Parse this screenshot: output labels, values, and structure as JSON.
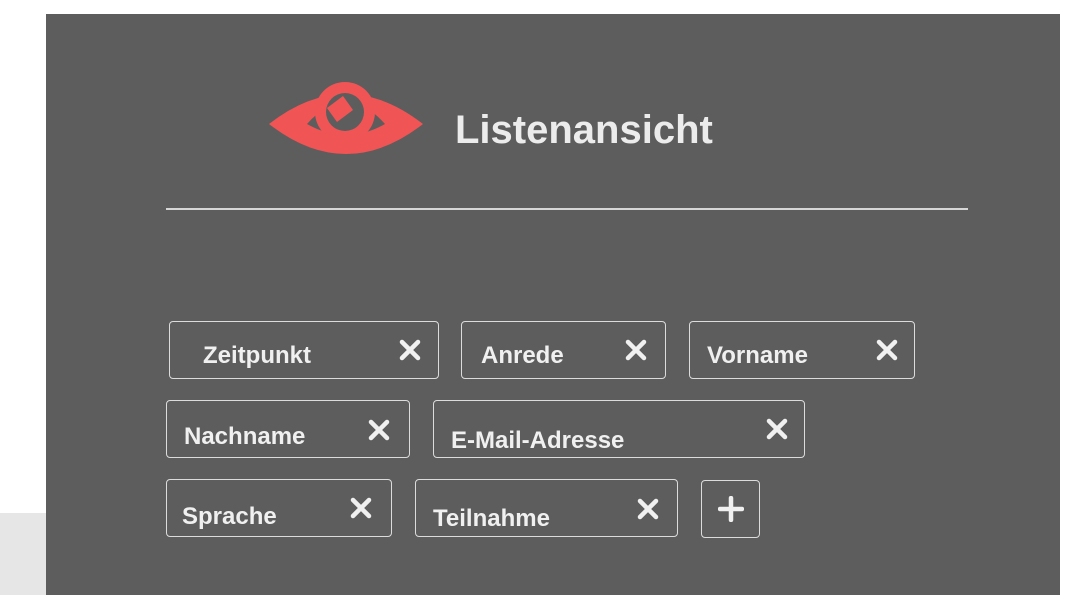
{
  "header": {
    "title": "Listenansicht",
    "icon": "eye-icon",
    "icon_color": "#f15454"
  },
  "columns": [
    {
      "label": "Zeitpunkt"
    },
    {
      "label": "Anrede"
    },
    {
      "label": "Vorname"
    },
    {
      "label": "Nachname"
    },
    {
      "label": "E-Mail-Adresse"
    },
    {
      "label": "Sprache"
    },
    {
      "label": "Teilnahme"
    }
  ],
  "add_button": {
    "icon": "plus-icon"
  },
  "colors": {
    "panel": "#5d5d5d",
    "text": "#f0f0f0",
    "border": "#dcdcdc",
    "accent": "#f15454"
  }
}
